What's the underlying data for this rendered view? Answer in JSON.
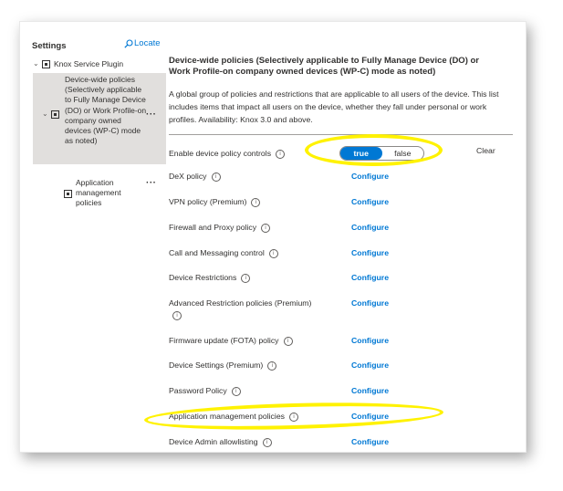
{
  "left": {
    "title": "Settings",
    "locate_label": "Locate",
    "tree": {
      "root_label": "Knox Service Plugin",
      "selected_label": "Device-wide policies (Selectively applicable to Fully Manage Device (DO) or Work Profile-on company owned devices (WP-C) mode as noted)",
      "child_label": "Application management policies"
    },
    "more": "···"
  },
  "main": {
    "heading": "Device-wide policies (Selectively applicable to Fully Manage Device (DO) or Work Profile-on company owned devices (WP-C) mode as noted)",
    "description": "A global group of policies and restrictions that are applicable to all users of the device. This list includes items that impact all users on the device, whether they fall under personal or work profiles. Availability: Knox 3.0 and above.",
    "enable_row": {
      "label": "Enable device policy controls",
      "true_label": "true",
      "false_label": "false",
      "selected": "true",
      "clear_label": "Clear"
    },
    "configure_label": "Configure",
    "info_glyph": "i",
    "policies": [
      {
        "label": "DeX policy"
      },
      {
        "label": "VPN policy (Premium)"
      },
      {
        "label": "Firewall and Proxy policy"
      },
      {
        "label": "Call and Messaging control"
      },
      {
        "label": "Device Restrictions"
      },
      {
        "label": "Advanced Restriction policies (Premium)"
      },
      {
        "label": "Firmware update (FOTA) policy"
      },
      {
        "label": "Device Settings (Premium)"
      },
      {
        "label": "Password Policy"
      },
      {
        "label": "Application management policies"
      },
      {
        "label": "Device Admin allowlisting"
      }
    ]
  },
  "colors": {
    "accent": "#0078d4",
    "highlight": "#fff200",
    "selected_bg": "#e1dfdd"
  },
  "icons": [
    "locate-icon",
    "chevron-down-icon",
    "policy-node-icon",
    "info-icon",
    "more-ellipsis-icon"
  ]
}
